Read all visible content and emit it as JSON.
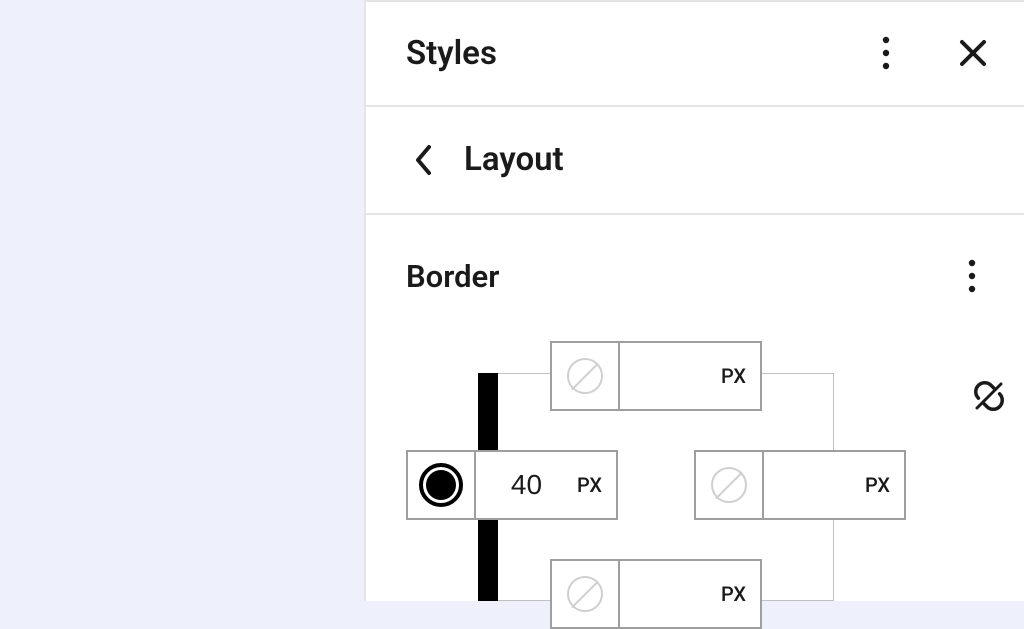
{
  "panel": {
    "title": "Styles"
  },
  "breadcrumb": {
    "label": "Layout"
  },
  "section": {
    "title": "Border"
  },
  "border": {
    "top": {
      "value": "",
      "unit": "PX",
      "color": "none"
    },
    "left": {
      "value": "40",
      "unit": "PX",
      "color": "black"
    },
    "right": {
      "value": "",
      "unit": "PX",
      "color": "none"
    },
    "bottom": {
      "value": "",
      "unit": "PX",
      "color": "none"
    },
    "linked": false
  }
}
